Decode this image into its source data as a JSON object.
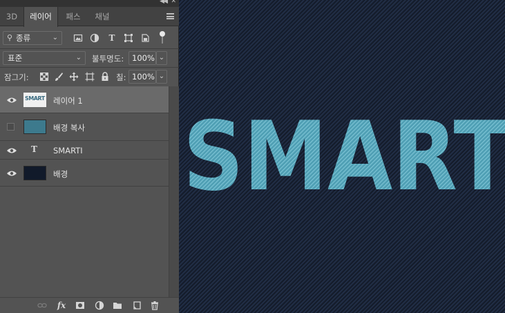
{
  "tabs": [
    {
      "label": "3D",
      "active": false
    },
    {
      "label": "레이어",
      "active": true
    },
    {
      "label": "패스",
      "active": false
    },
    {
      "label": "채널",
      "active": false
    }
  ],
  "filter": {
    "kind_label": "종류",
    "icons": [
      "image-filter-icon",
      "adjustment-filter-icon",
      "type-filter-icon",
      "shape-filter-icon",
      "smart-object-filter-icon"
    ]
  },
  "blend": {
    "mode": "표준",
    "opacity_label": "불투명도:",
    "opacity_value": "100%"
  },
  "lock": {
    "label": "잠그기:",
    "fill_label": "칠:",
    "fill_value": "100%"
  },
  "layers": [
    {
      "name": "레이어 1",
      "visible": true,
      "selected": true,
      "thumb_text": "SMART"
    },
    {
      "name": "배경 복사",
      "visible": false,
      "selected": false,
      "thumb_color": "#3d7a8d"
    },
    {
      "name": "SMARTI",
      "visible": true,
      "selected": false,
      "thumb_type": "T"
    },
    {
      "name": "배경",
      "visible": true,
      "selected": false,
      "thumb_color": "#111a2a"
    }
  ],
  "canvas": {
    "text": "SMARTI",
    "text_color": "#5aa9bd",
    "bg_color": "#1a2436"
  },
  "colors": {
    "panel_bg": "#535353",
    "selected_row": "#6a6a6a",
    "tab_bg": "#424242"
  }
}
